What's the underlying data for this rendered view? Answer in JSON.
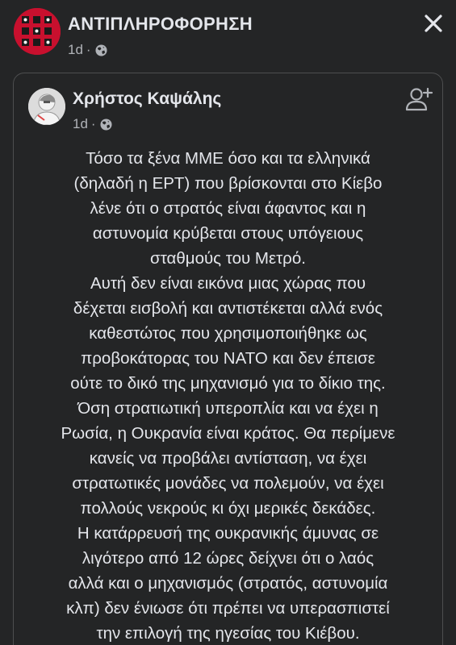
{
  "page": {
    "name": "ΑΝΤΙΠΛΗΡΟΦΟΡΗΣΗ",
    "time": "1d",
    "audience_icon": "globe-icon"
  },
  "close_icon": "close-icon",
  "shared_post": {
    "author": "Χρήστος Καψάλης",
    "time": "1d",
    "audience_icon": "globe-icon",
    "add_friend_icon": "add-friend-icon",
    "text_lines": [
      "Τόσο τα ξένα ΜΜΕ όσο και τα ελληνικά",
      "(δηλαδή η ΕΡΤ) που βρίσκονται στο Κίεβο",
      "λένε ότι ο στρατός είναι άφαντος και η",
      "αστυνομία κρύβεται στους υπόγειους",
      "σταθμούς του Μετρό.",
      "Αυτή δεν είναι εικόνα μιας χώρας που",
      "δέχεται εισβολή και αντιστέκεται αλλά ενός",
      "καθεστώτος που χρησιμοποιήθηκε ως",
      "προβοκάτορας του ΝΑΤΟ και δεν έπεισε",
      "ούτε το δικό της μηχανισμό για το δίκιο της.",
      "Όση στρατιωτική υπεροπλία και να έχει η",
      "Ρωσία, η Ουκρανία είναι κράτος. Θα περίμενε",
      "κανείς να προβάλει αντίσταση, να έχει",
      "στρατωτικές μονάδες να πολεμούν, να έχει",
      "πολλούς νεκρούς κι όχι μερικές δεκάδες.",
      "Η κατάρρευσή της ουκρανικής άμυνας σε",
      "λιγότερο από 12 ώρες δείχνει ότι ο λαός",
      "αλλά και ο μηχανισμός (στρατός, αστυνομία",
      "κλπ) δεν ένιωσε ότι πρέπει να υπερασπιστεί",
      "την επιλογή της ηγεσίας του Κιέβου."
    ]
  },
  "colors": {
    "background": "#242526",
    "text": "#e4e6eb",
    "secondary_text": "#b0b3b8",
    "card_border": "#4e4f50",
    "page_avatar_red": "#c8102e"
  }
}
